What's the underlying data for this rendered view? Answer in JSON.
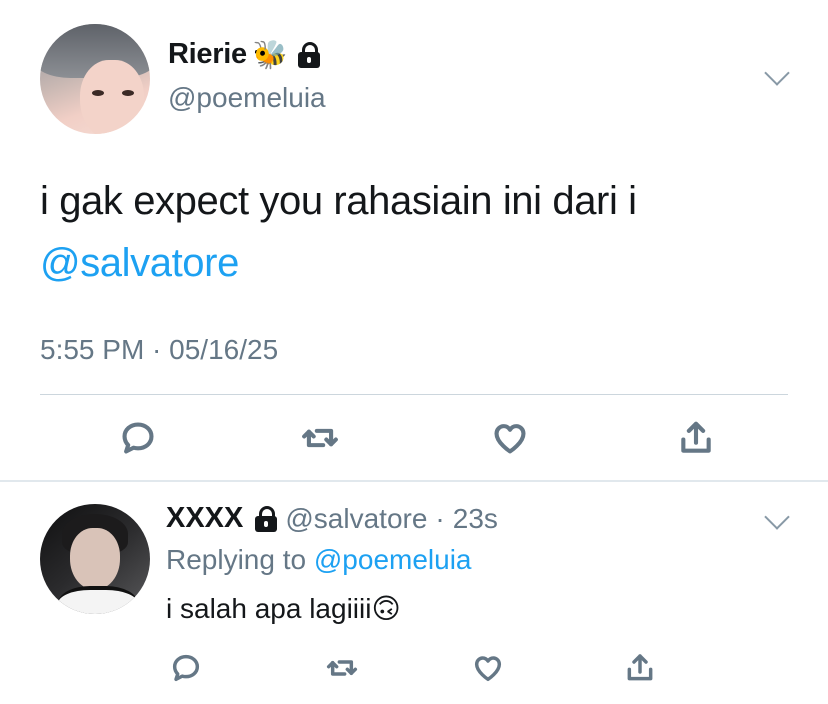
{
  "main_tweet": {
    "display_name": "Rierie",
    "name_emoji": "🐝",
    "handle": "@poemeluia",
    "text": "i gak expect you rahasiain ini dari i",
    "mention": "@salvatore",
    "timestamp": "5:55 PM · 05/16/25",
    "icons": [
      "reply-icon",
      "retweet-icon",
      "like-icon",
      "share-icon"
    ]
  },
  "reply": {
    "display_name": "XXXX",
    "handle": "@salvatore",
    "separator": "·",
    "time": "23s",
    "replying_prefix": "Replying to",
    "replying_to": "@poemeluia",
    "text": "i salah apa lagiiii",
    "emoji": "🙃",
    "icons": [
      "reply-icon",
      "retweet-icon",
      "like-icon",
      "share-icon"
    ]
  },
  "colors": {
    "link": "#1da1f2",
    "secondary_text": "#657786",
    "primary_text": "#14171a",
    "divider": "#ccd6dd"
  }
}
